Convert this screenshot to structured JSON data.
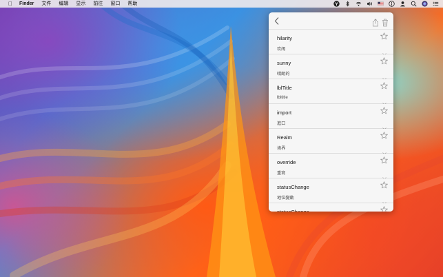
{
  "menubar": {
    "apple_icon": "apple-logo-icon",
    "app_name": "Finder",
    "menus": [
      "文件",
      "编辑",
      "显示",
      "前往",
      "窗口",
      "帮助"
    ],
    "tray_icons": [
      "translate-app-icon",
      "bluetooth-icon",
      "wifi-icon",
      "volume-icon",
      "flag-input-icon",
      "info-icon",
      "user-icon",
      "search-icon",
      "siri-icon",
      "list-icon"
    ]
  },
  "popover": {
    "header": {
      "back_icon": "chevron-left-icon",
      "share_icon": "share-icon",
      "trash_icon": "trash-icon"
    },
    "entries": [
      {
        "word": "hilarity",
        "meaning": "欢闹"
      },
      {
        "word": "sunny",
        "meaning": "晴朗的"
      },
      {
        "word": "lblTitle",
        "meaning": "lbltitle"
      },
      {
        "word": "import",
        "meaning": "進口"
      },
      {
        "word": "Realm",
        "meaning": "境界"
      },
      {
        "word": "override",
        "meaning": "重寫"
      },
      {
        "word": "statusChange",
        "meaning": "地位變動"
      },
      {
        "word": "statusChange",
        "meaning": ""
      }
    ]
  }
}
